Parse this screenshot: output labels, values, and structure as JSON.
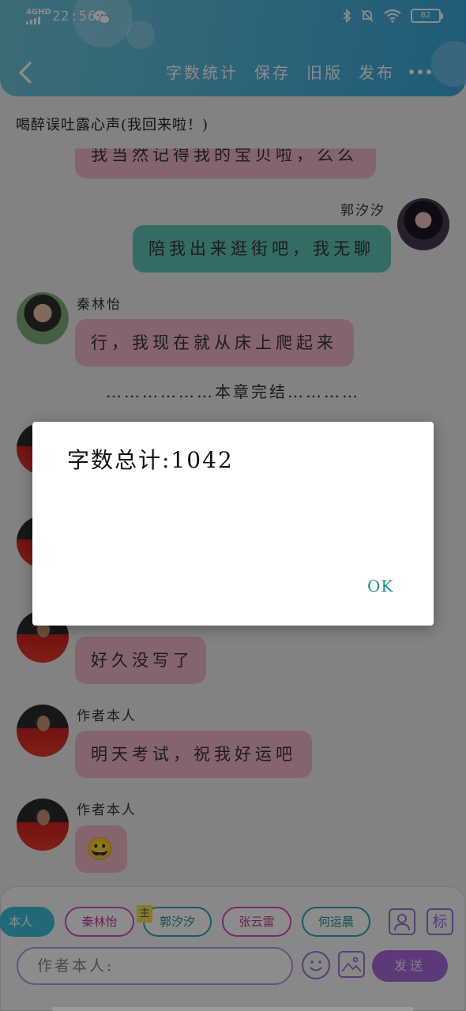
{
  "status_bar": {
    "signal_label": "4GHD",
    "time": "22:56",
    "battery": "82"
  },
  "nav": {
    "actions": [
      "字数统计",
      "保存",
      "旧版",
      "发布"
    ]
  },
  "chapter_title": "喝醉误吐露心声(我回来啦！)",
  "messages": {
    "partial_top": "我当然记得我的宝贝啦，么么",
    "guo": {
      "name": "郭汐汐",
      "text": "陪我出来逛街吧，我无聊"
    },
    "qin": {
      "name": "秦林怡",
      "text": "行，我现在就从床上爬起来"
    },
    "chapter_end": "………………本章完结…………",
    "m1": {
      "name": "作者本人",
      "text": "好久没写了"
    },
    "m2": {
      "name": "作者本人",
      "text": "明天考试，祝我好运吧"
    },
    "m3": {
      "name": "作者本人",
      "text": "😀"
    }
  },
  "dialog": {
    "message": "字数总计:1042",
    "ok_label": "OK"
  },
  "bottom": {
    "characters": [
      "本人",
      "秦林怡",
      "郭汐汐",
      "张云雷",
      "何运晨"
    ],
    "host_tag": "主",
    "tag_icon_label": "标",
    "input_value": "作者本人:",
    "send_label": "发送"
  },
  "colors": {
    "header": "#58b8d9",
    "bubble_pink": "#f1b9c6",
    "bubble_teal": "#5fc3b9",
    "send": "#a66ad9",
    "ok": "#1b8d8a"
  }
}
